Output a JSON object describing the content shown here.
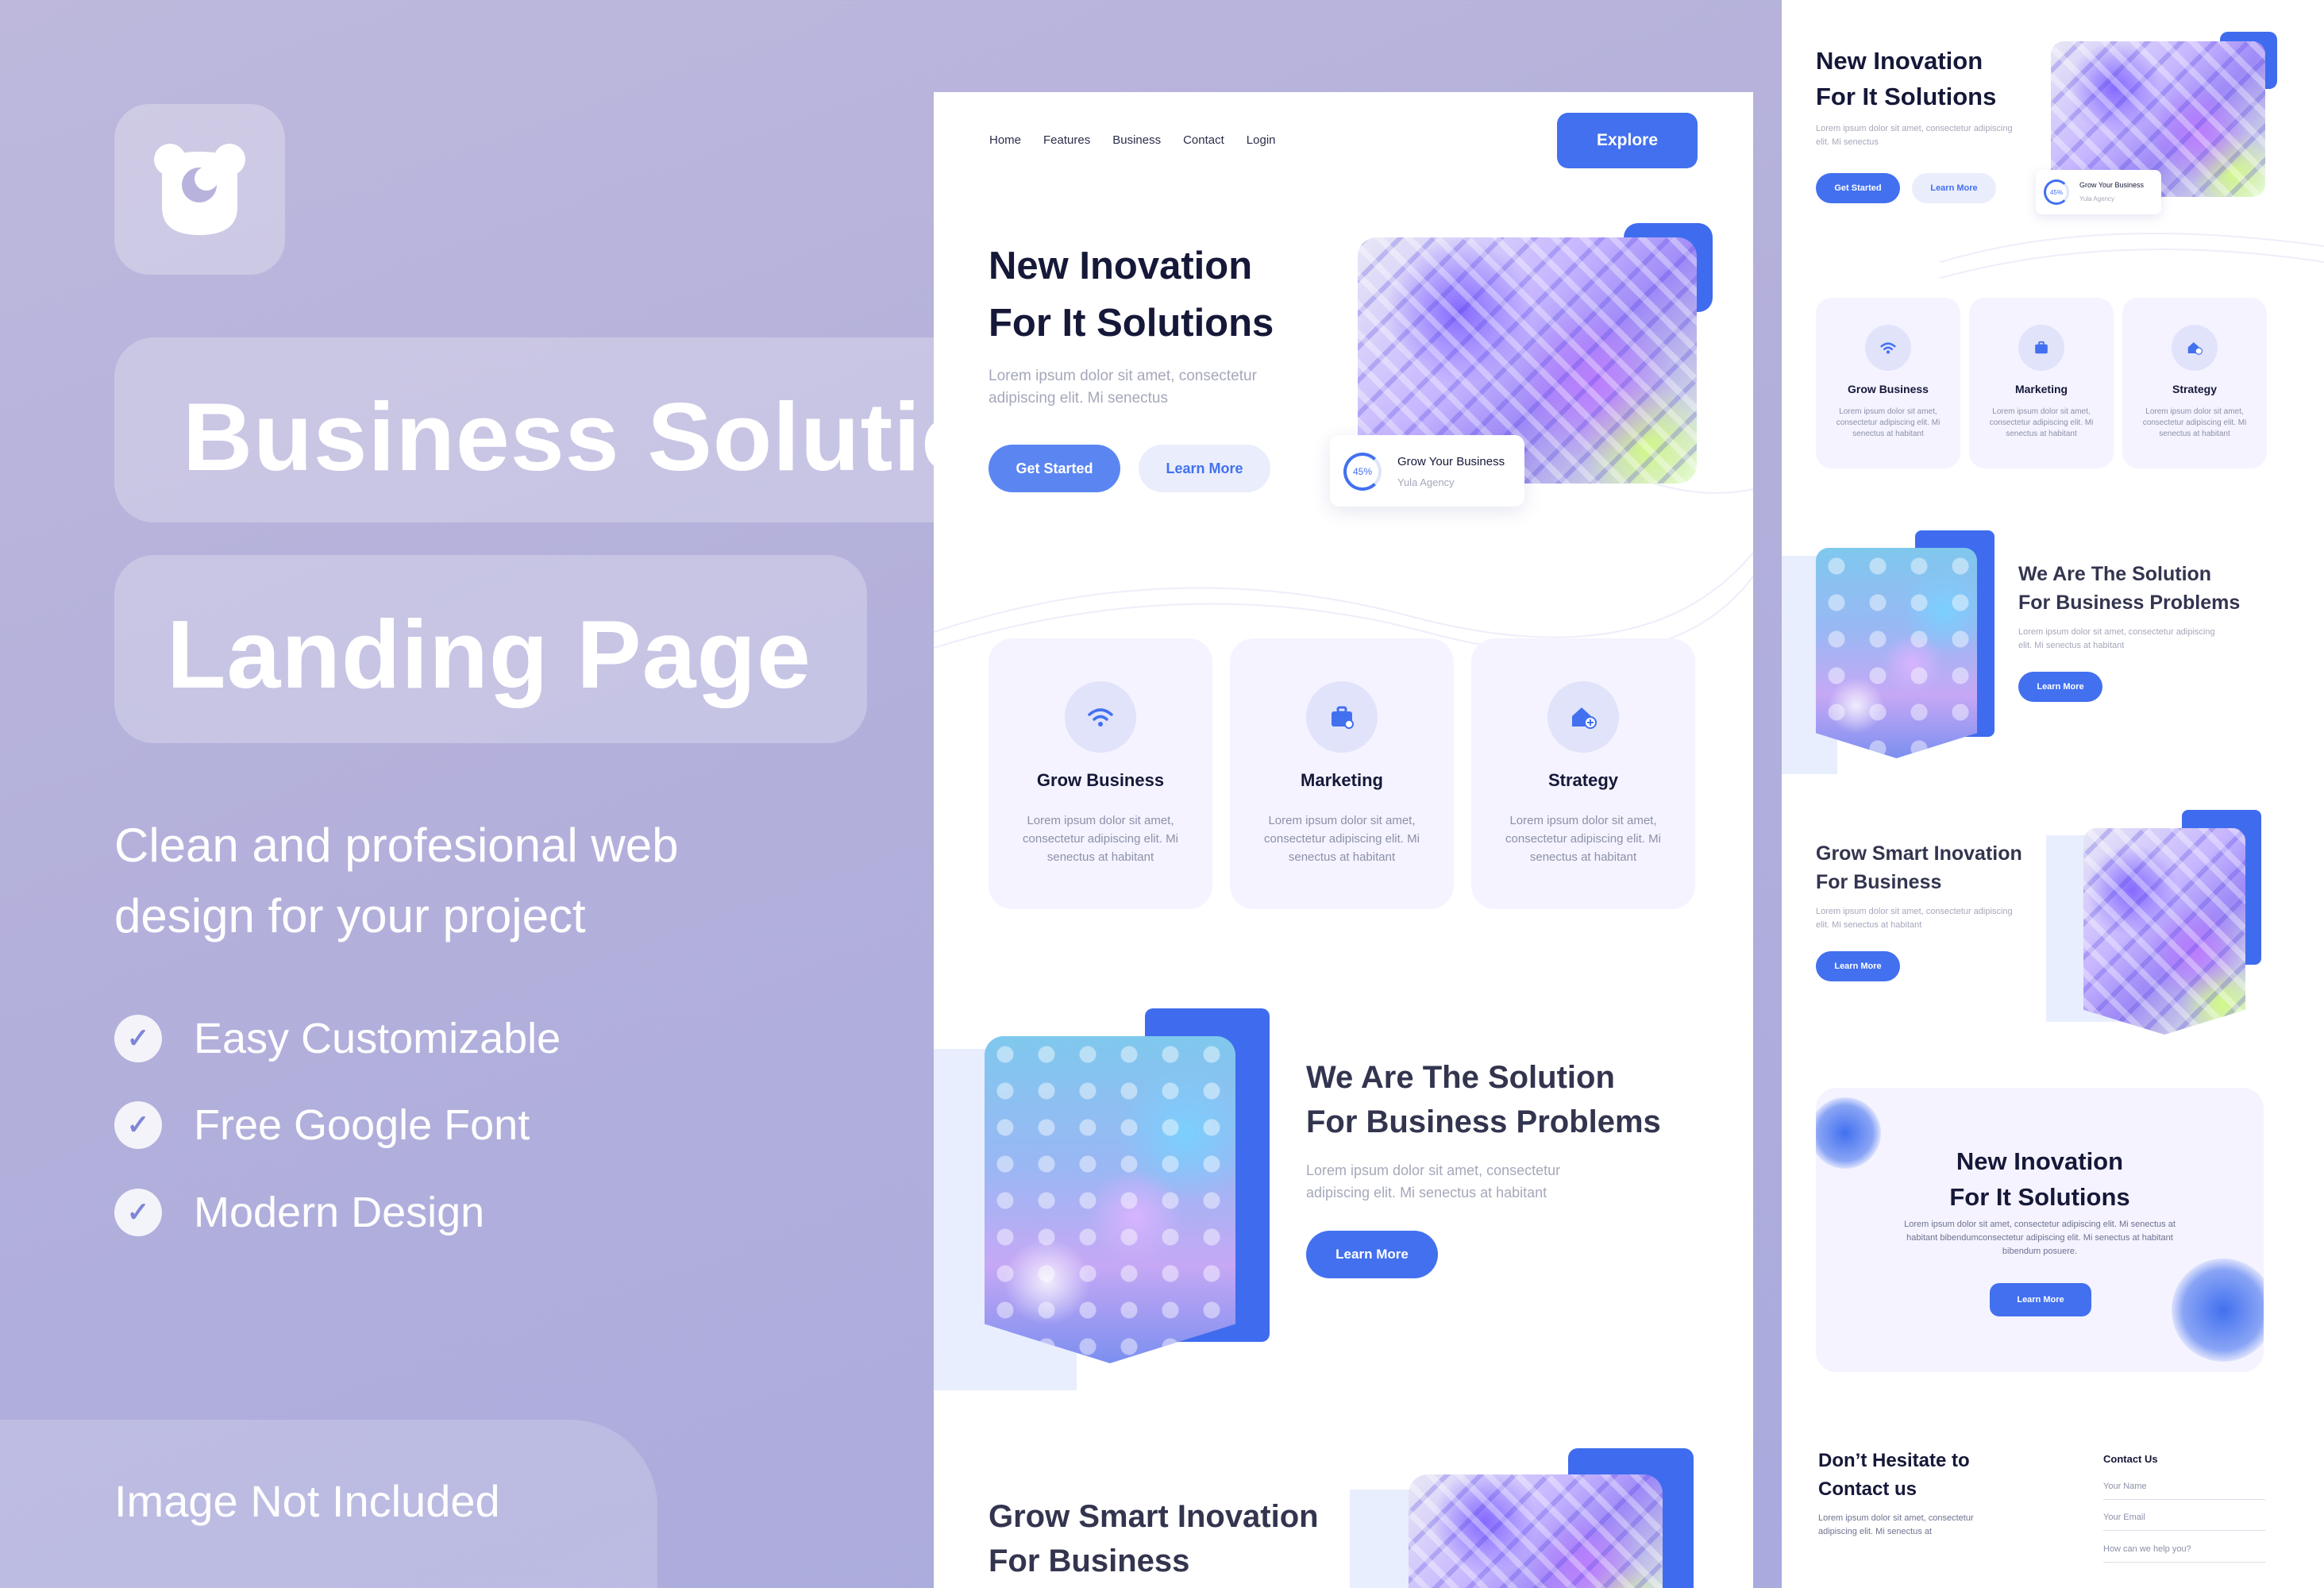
{
  "promo": {
    "title_line1": "Business Solutions",
    "title_line2": "Landing Page",
    "subtitle": "Clean and profesional web design for your project",
    "features": [
      "Easy Customizable",
      "Free Google Font",
      "Modern Design"
    ],
    "note": "Image Not Included",
    "logo_icon": "bear-logo-icon",
    "check_icon": "check-icon"
  },
  "main": {
    "nav": [
      "Home",
      "Features",
      "Business",
      "Contact",
      "Login"
    ],
    "explore_label": "Explore",
    "hero": {
      "title_line1": "New Inovation",
      "title_line2": "For It Solutions",
      "text": "Lorem ipsum dolor sit amet, consectetur adipiscing elit. Mi senectus",
      "get_started": "Get Started",
      "learn_more": "Learn More"
    },
    "stat": {
      "percent": "45%",
      "title": "Grow Your Business",
      "subtitle": "Yula Agency"
    },
    "services": [
      {
        "title": "Grow Business",
        "text": "Lorem ipsum dolor sit amet, consectetur adipiscing elit. Mi senectus at habitant",
        "icon": "wifi-icon"
      },
      {
        "title": "Marketing",
        "text": "Lorem ipsum dolor sit amet, consectetur adipiscing elit. Mi senectus at habitant",
        "icon": "briefcase-icon"
      },
      {
        "title": "Strategy",
        "text": "Lorem ipsum dolor sit amet, consectetur adipiscing elit. Mi senectus at habitant",
        "icon": "house-plus-icon"
      }
    ],
    "solution": {
      "title_line1": "We Are The Solution",
      "title_line2": "For Business Problems",
      "text": "Lorem ipsum dolor sit amet, consectetur adipiscing elit. Mi senectus at habitant",
      "button": "Learn More"
    },
    "grow": {
      "title_line1": "Grow Smart Inovation",
      "title_line2": "For Business"
    }
  },
  "side": {
    "hero": {
      "title_line1": "New Inovation",
      "title_line2": "For It Solutions",
      "text": "Lorem ipsum dolor sit amet, consectetur adipiscing elit. Mi senectus",
      "get_started": "Get Started",
      "learn_more": "Learn More"
    },
    "stat": {
      "percent": "45%",
      "title": "Grow Your Business",
      "subtitle": "Yula Agency"
    },
    "services": [
      {
        "title": "Grow Business",
        "text": "Lorem ipsum dolor sit amet, consectetur adipiscing elit. Mi senectus at habitant"
      },
      {
        "title": "Marketing",
        "text": "Lorem ipsum dolor sit amet, consectetur adipiscing elit. Mi senectus at habitant"
      },
      {
        "title": "Strategy",
        "text": "Lorem ipsum dolor sit amet, consectetur adipiscing elit. Mi senectus at habitant"
      }
    ],
    "solution": {
      "title_line1": "We Are The Solution",
      "title_line2": "For Business Problems",
      "text": "Lorem ipsum dolor sit amet, consectetur adipiscing elit. Mi senectus at habitant",
      "button": "Learn More"
    },
    "grow": {
      "title_line1": "Grow Smart Inovation",
      "title_line2": "For Business",
      "text": "Lorem ipsum dolor sit amet, consectetur adipiscing elit. Mi senectus at habitant",
      "button": "Learn More"
    },
    "cta": {
      "title_line1": "New Inovation",
      "title_line2": "For It Solutions",
      "text": "Lorem ipsum dolor sit amet, consectetur adipiscing elit. Mi senectus at habitant bibendumconsectetur adipiscing elit. Mi senectus at habitant bibendum posuere.",
      "button": "Learn More"
    },
    "contact": {
      "title_line1": "Don’t Hesitate to",
      "title_line2": "Contact us",
      "text": "Lorem ipsum dolor sit amet, consectetur adipiscing elit. Mi senectus at",
      "form_title": "Contact Us",
      "name_placeholder": "Your Name",
      "email_placeholder": "Your Email",
      "message_placeholder": "How can we help you?"
    }
  },
  "colors": {
    "accent": "#4270ef",
    "soft_card": "#f4f3ff",
    "background": "#b3b0db"
  }
}
